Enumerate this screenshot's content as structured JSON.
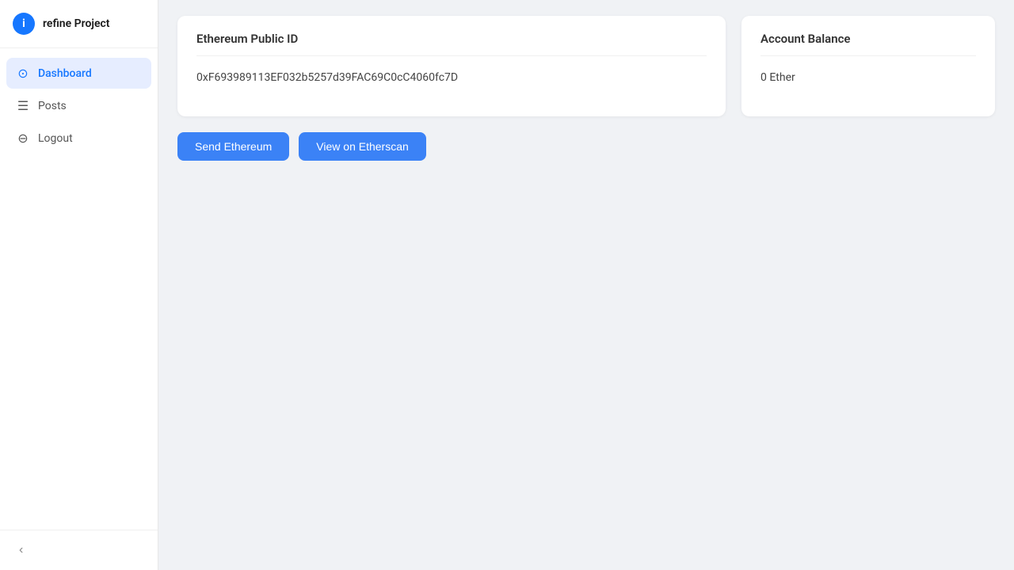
{
  "app": {
    "title": "refine Project",
    "logo_letter": "i"
  },
  "sidebar": {
    "items": [
      {
        "id": "dashboard",
        "label": "Dashboard",
        "icon": "⊙",
        "active": true
      },
      {
        "id": "posts",
        "label": "Posts",
        "icon": "☰",
        "active": false
      },
      {
        "id": "logout",
        "label": "Logout",
        "icon": "⊖",
        "active": false
      }
    ],
    "collapse_icon": "‹"
  },
  "main": {
    "ethereum_card": {
      "title": "Ethereum Public ID",
      "value": "0xF693989113EF032b5257d39FAC69C0cC4060fc7D"
    },
    "balance_card": {
      "title": "Account Balance",
      "value": "0 Ether"
    },
    "buttons": [
      {
        "id": "send-ethereum",
        "label": "Send Ethereum"
      },
      {
        "id": "view-etherscan",
        "label": "View on Etherscan"
      }
    ]
  }
}
